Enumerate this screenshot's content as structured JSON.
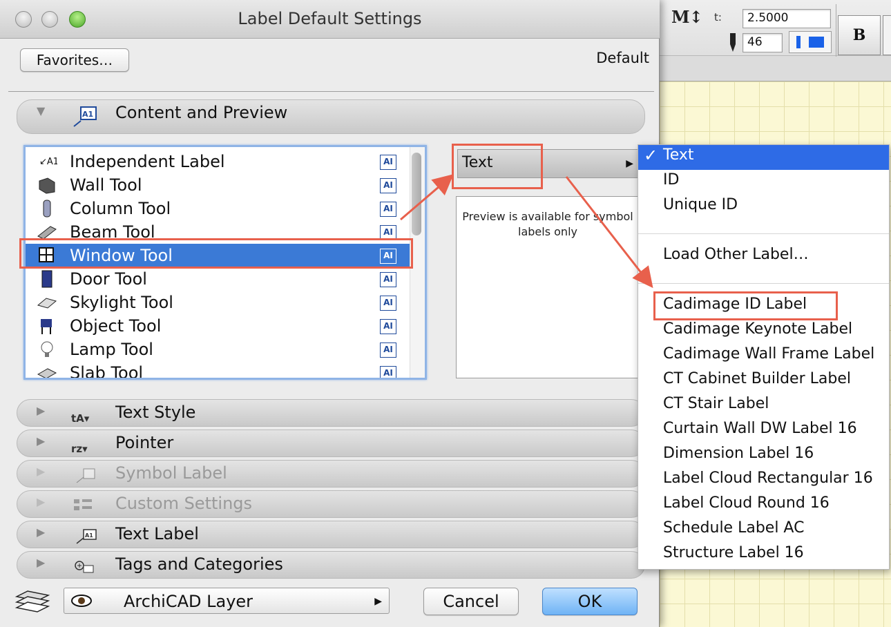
{
  "window": {
    "title": "Label Default Settings"
  },
  "header": {
    "favorites_label": "Favorites…",
    "default_label": "Default"
  },
  "toolbar": {
    "height_label": "t:",
    "height_value": "2.5000",
    "pen_value": "46",
    "bold_label": "B"
  },
  "panels": {
    "content": "Content and Preview",
    "text_style": "Text Style",
    "pointer": "Pointer",
    "symbol_label": "Symbol Label",
    "custom_settings": "Custom Settings",
    "text_label": "Text Label",
    "tags": "Tags and Categories"
  },
  "tool_list": [
    {
      "label": "Independent Label",
      "icon": "independent-label-icon",
      "badge": "AI"
    },
    {
      "label": "Wall Tool",
      "icon": "wall-tool-icon",
      "badge": "AI"
    },
    {
      "label": "Column Tool",
      "icon": "column-tool-icon",
      "badge": "AI"
    },
    {
      "label": "Beam Tool",
      "icon": "beam-tool-icon",
      "badge": "AI"
    },
    {
      "label": "Window Tool",
      "icon": "window-tool-icon",
      "badge": "AI",
      "selected": true
    },
    {
      "label": "Door Tool",
      "icon": "door-tool-icon",
      "badge": "AI"
    },
    {
      "label": "Skylight Tool",
      "icon": "skylight-tool-icon",
      "badge": "AI"
    },
    {
      "label": "Object Tool",
      "icon": "object-tool-icon",
      "badge": "AI"
    },
    {
      "label": "Lamp Tool",
      "icon": "lamp-tool-icon",
      "badge": "AI"
    },
    {
      "label": "Slab Tool",
      "icon": "slab-tool-icon",
      "badge": "AI"
    }
  ],
  "label_type": {
    "value": "Text"
  },
  "preview": {
    "message": "Preview is available for symbol labels only"
  },
  "menu": {
    "group1": [
      "Text",
      "ID",
      "Unique ID"
    ],
    "load_other": "Load Other Label…",
    "group2": [
      "Cadimage ID Label",
      "Cadimage Keynote Label",
      "Cadimage Wall Frame Label",
      "CT Cabinet Builder Label",
      "CT Stair Label",
      "Curtain Wall DW Label 16",
      "Dimension Label 16",
      "Label Cloud Rectangular 16",
      "Label Cloud Round 16",
      "Schedule Label AC",
      "Structure Label 16"
    ],
    "selected": "Text"
  },
  "footer": {
    "layer": "ArchiCAD Layer",
    "cancel": "Cancel",
    "ok": "OK"
  },
  "colors": {
    "selection": "#3b7ad6",
    "menu_selection": "#2e6be6",
    "callout": "#e8604c",
    "ok_button": "#6fb3f5"
  }
}
